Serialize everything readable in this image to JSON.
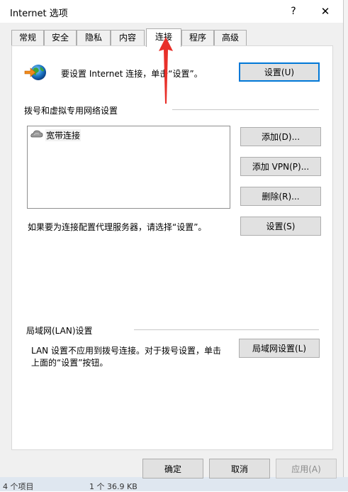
{
  "window": {
    "title": "Internet 选项",
    "help": "?",
    "close": "✕"
  },
  "tabs": [
    {
      "label": "常规"
    },
    {
      "label": "安全"
    },
    {
      "label": "隐私"
    },
    {
      "label": "内容"
    },
    {
      "label": "连接",
      "active": true
    },
    {
      "label": "程序"
    },
    {
      "label": "高级"
    }
  ],
  "setup": {
    "text": "要设置 Internet 连接，单击“设置”。",
    "button": "设置(U)",
    "icon": "globe-arrow-icon"
  },
  "dialup": {
    "group_title": "拨号和虚拟专用网络设置",
    "items": [
      {
        "label": "宽带连接",
        "icon": "broadband-connection-icon"
      }
    ],
    "add_button": "添加(D)...",
    "add_vpn_button": "添加 VPN(P)...",
    "remove_button": "删除(R)...",
    "proxy_text": "如果要为连接配置代理服务器，请选择“设置”。",
    "settings_button": "设置(S)"
  },
  "lan": {
    "group_title": "局域网(LAN)设置",
    "text_line1": "LAN 设置不应用到拨号连接。对于拨号设置，单击",
    "text_line2": "上面的“设置”按钮。",
    "button": "局域网设置(L)"
  },
  "footer": {
    "ok": "确定",
    "cancel": "取消",
    "apply": "应用(A)"
  },
  "background": {
    "left_text": "4 个项目",
    "right_text": "1 个 36.9 KB"
  },
  "colors": {
    "dialog_bg": "#f0f0f0",
    "panel_bg": "#ffffff",
    "default_button_border": "#0078d7",
    "annotation_arrow": "#e8302a"
  }
}
